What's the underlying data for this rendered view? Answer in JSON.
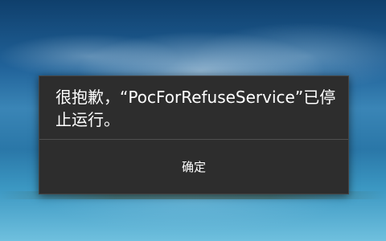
{
  "dialog": {
    "message": "很抱歉，“PocForRefuseService”已停止运行。",
    "ok_label": "确定"
  }
}
